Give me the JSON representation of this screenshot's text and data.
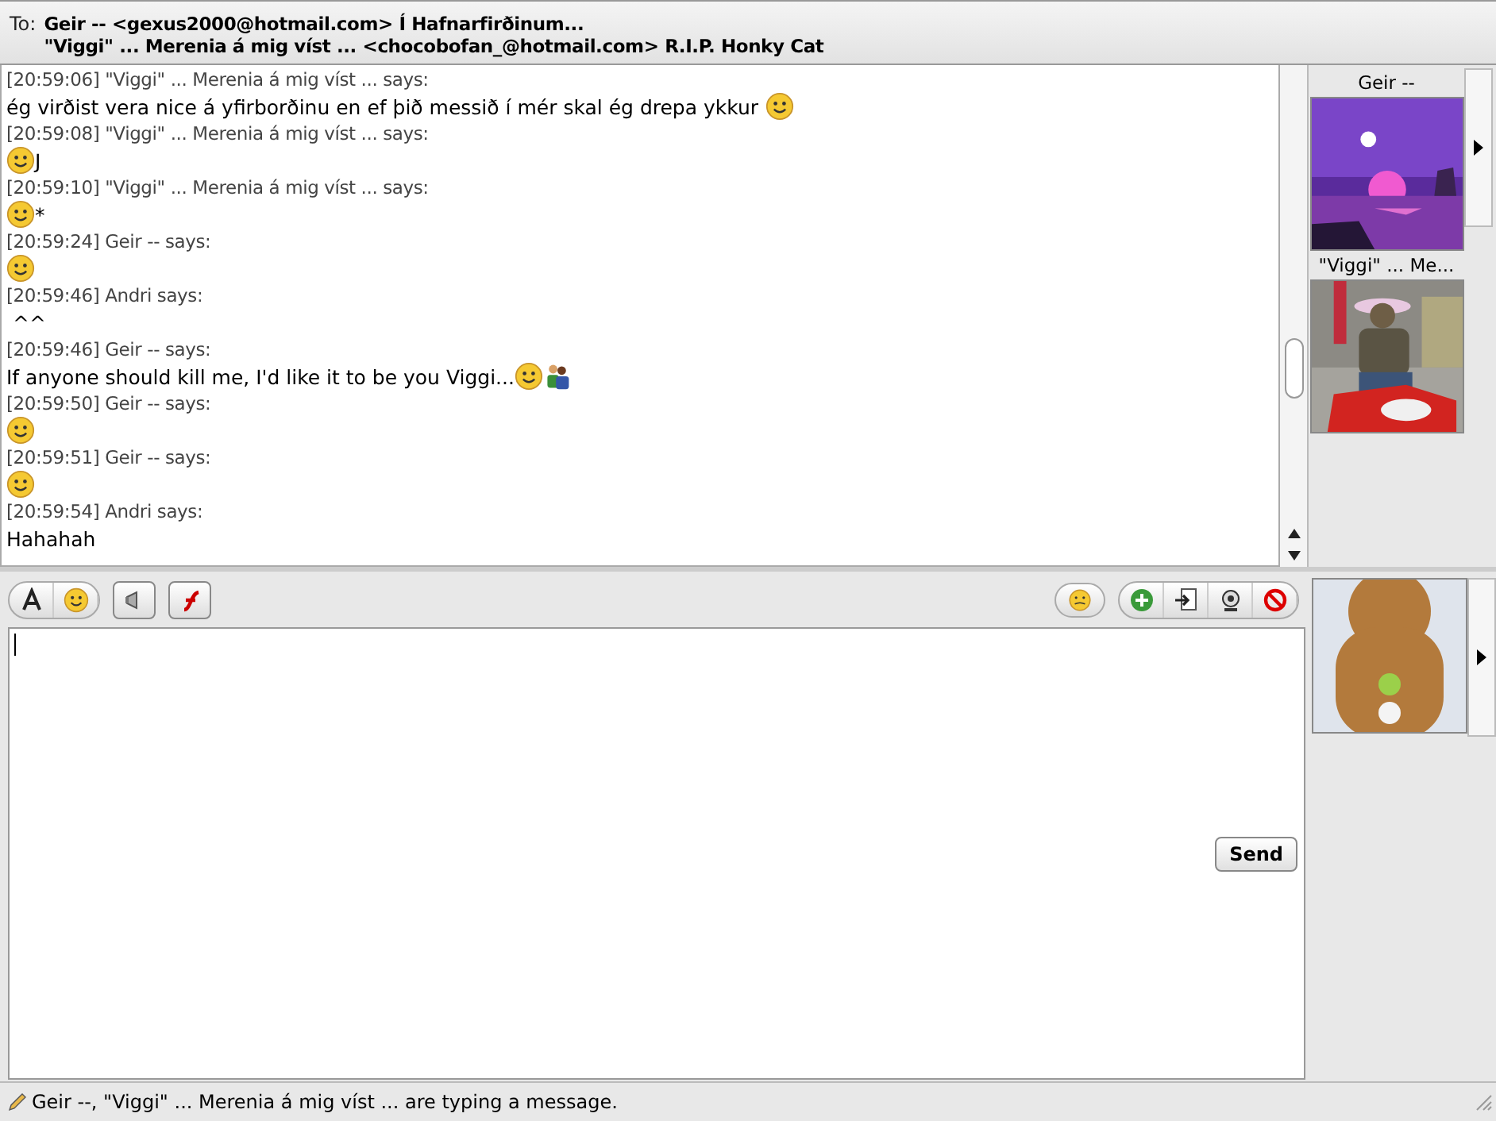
{
  "to_label": "To:",
  "recipients": [
    "Geir -- <gexus2000@hotmail.com> Í Hafnarfirðinum...",
    "\"Viggi\" ... Merenia á mig víst ... <chocobofan_@hotmail.com> R.I.P. Honky Cat"
  ],
  "messages": [
    {
      "header": "[20:59:06] \"Viggi\" ... Merenia á mig víst ... says:",
      "parts": [
        {
          "kind": "text",
          "text": "ég virðist vera nice á yfirborðinu en ef þið messið í mér skal ég drepa ykkur "
        },
        {
          "kind": "emoticon"
        }
      ]
    },
    {
      "header": "[20:59:08] \"Viggi\" ... Merenia á mig víst ... says:",
      "parts": [
        {
          "kind": "emoticon"
        },
        {
          "kind": "text",
          "text": "J"
        }
      ]
    },
    {
      "header": "[20:59:10] \"Viggi\" ... Merenia á mig víst ... says:",
      "parts": [
        {
          "kind": "emoticon"
        },
        {
          "kind": "text",
          "text": "*"
        }
      ]
    },
    {
      "header": "[20:59:24] Geir -- says:",
      "parts": [
        {
          "kind": "emoticon"
        }
      ]
    },
    {
      "header": "[20:59:46] Andri  says:",
      "parts": [
        {
          "kind": "text",
          "text": " ^^"
        }
      ]
    },
    {
      "header": "[20:59:46] Geir -- says:",
      "parts": [
        {
          "kind": "text",
          "text": "If anyone should kill me, I'd like it to be you Viggi..."
        },
        {
          "kind": "emoticon"
        },
        {
          "kind": "people"
        }
      ]
    },
    {
      "header": "[20:59:50] Geir -- says:",
      "parts": [
        {
          "kind": "emoticon"
        }
      ]
    },
    {
      "header": "[20:59:51] Geir -- says:",
      "parts": [
        {
          "kind": "emoticon"
        }
      ]
    },
    {
      "header": "[20:59:54] Andri  says:",
      "parts": [
        {
          "kind": "text",
          "text": "Hahahah"
        }
      ]
    }
  ],
  "contacts": [
    {
      "name": "Geir --"
    },
    {
      "name": "\"Viggi\" ... Me..."
    }
  ],
  "send_button": "Send",
  "status": "Geir --, \"Viggi\" ... Merenia á mig víst ... are typing a message."
}
